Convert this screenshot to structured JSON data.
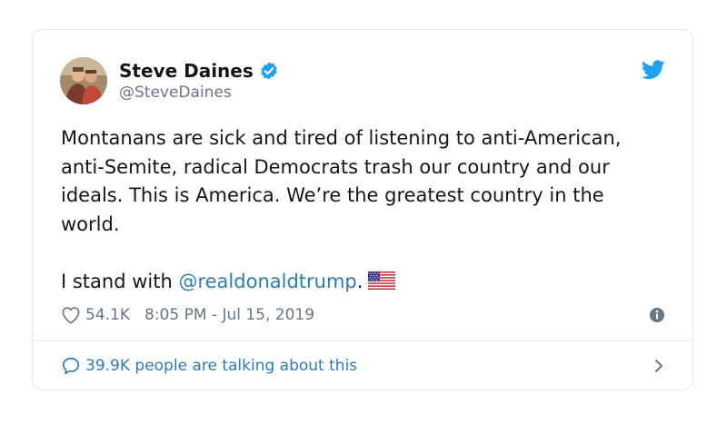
{
  "tweet": {
    "display_name": "Steve Daines",
    "handle": "@SteveDaines",
    "text_paragraph": "Montanans are sick and tired of listening to anti-American, anti-Semite, radical Democrats trash our country and our ideals. This is America. We’re the greatest country in the world.",
    "closing_prefix": "I stand with ",
    "mention": "@realdonaldtrump",
    "closing_suffix": ".",
    "likes": "54.1K",
    "timestamp": "8:05 PM - Jul 15, 2019",
    "talking_label": "39.9K people are talking about this"
  },
  "colors": {
    "twitter_blue": "#1da1f2",
    "link_blue": "#2b7bb9",
    "secondary_gray": "#657786",
    "border": "#e1e8ed"
  },
  "icons": [
    "verified-badge-icon",
    "twitter-bird-icon",
    "us-flag-emoji",
    "heart-icon",
    "info-icon",
    "speech-bubble-icon",
    "chevron-right-icon"
  ]
}
